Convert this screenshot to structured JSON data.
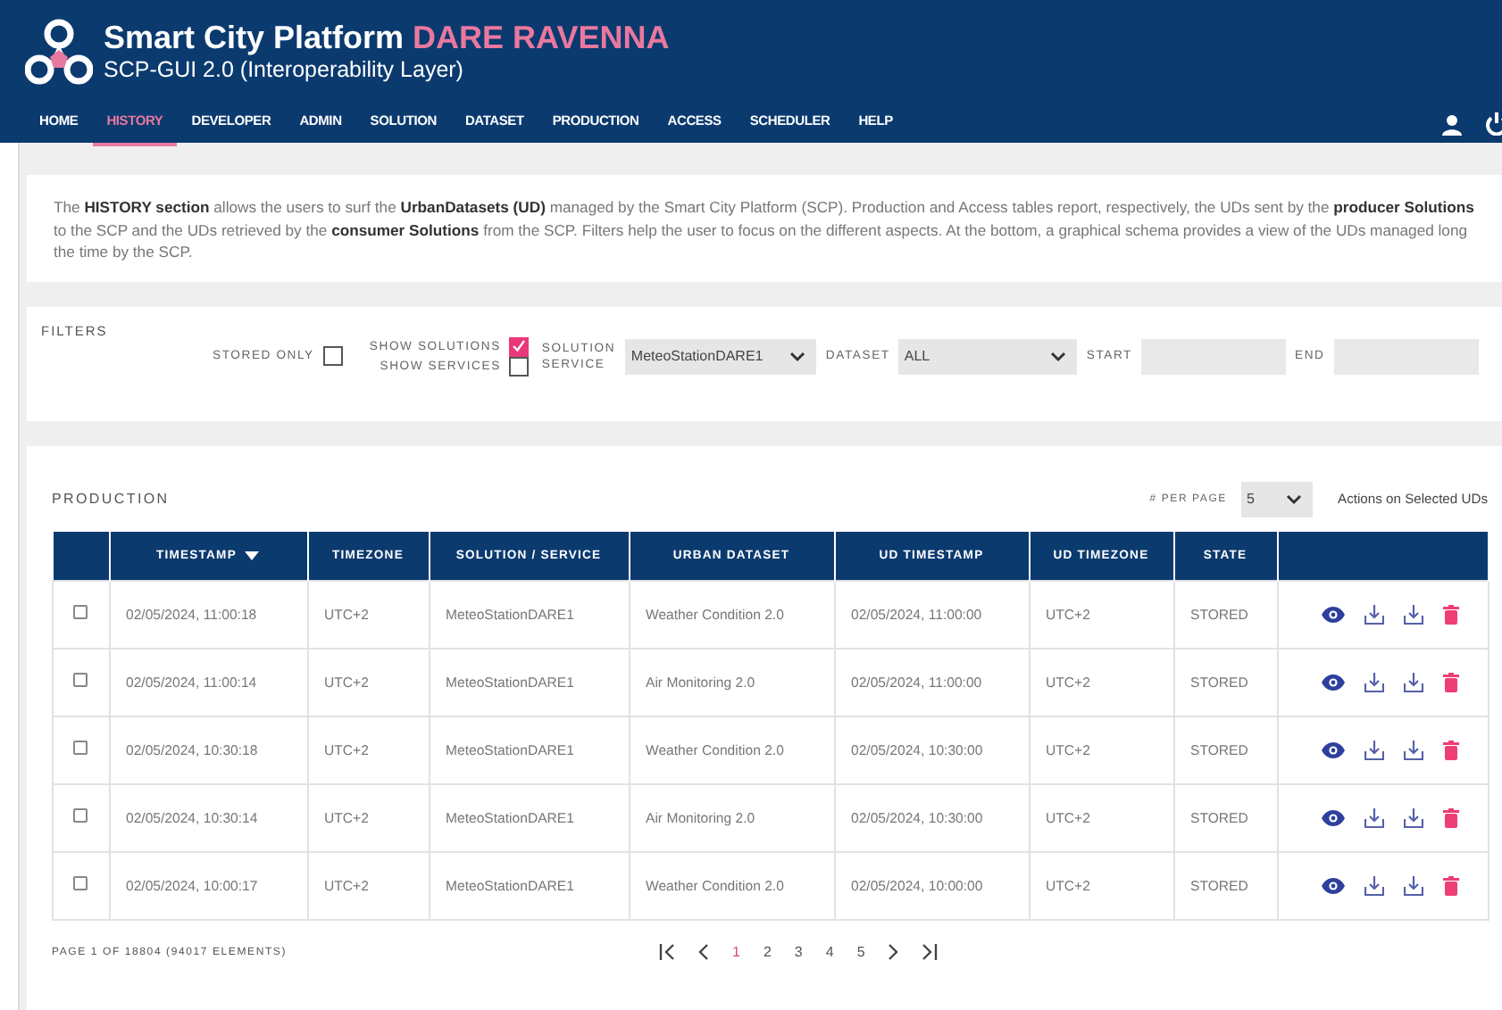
{
  "header": {
    "title": "Smart City Platform",
    "title_accent": "DARE RAVENNA",
    "subtitle": "SCP-GUI 2.0 (Interoperability Layer)"
  },
  "nav": [
    {
      "label": "HOME",
      "selected": false
    },
    {
      "label": "HISTORY",
      "selected": true
    },
    {
      "label": "DEVELOPER",
      "selected": false
    },
    {
      "label": "ADMIN",
      "selected": false
    },
    {
      "label": "SOLUTION",
      "selected": false
    },
    {
      "label": "DATASET",
      "selected": false
    },
    {
      "label": "PRODUCTION",
      "selected": false
    },
    {
      "label": "ACCESS",
      "selected": false
    },
    {
      "label": "SCHEDULER",
      "selected": false
    },
    {
      "label": "HELP",
      "selected": false
    }
  ],
  "intro": "The **HISTORY section** allows the users to surf the **UrbanDatasets (UD)** managed by the Smart City Platform (SCP). Production and Access tables report, respectively, the UDs sent by the **producer Solutions** to the SCP and the UDs retrieved by the **consumer Solutions** from the SCP. Filters help the user to focus on the different aspects. At the bottom, a graphical schema provides a view of the UDs managed long the time by the SCP.",
  "filters": {
    "title": "FILTERS",
    "stored_only": {
      "label": "STORED ONLY",
      "checked": false
    },
    "show_solutions": {
      "label": "SHOW SOLUTIONS",
      "checked": true
    },
    "show_services": {
      "label": "SHOW SERVICES",
      "checked": false
    },
    "solution_service": {
      "label": "SOLUTION SERVICE",
      "value": "MeteoStationDARE1"
    },
    "dataset": {
      "label": "DATASET",
      "value": "ALL"
    },
    "start": {
      "label": "START"
    },
    "end": {
      "label": "END"
    }
  },
  "production": {
    "title": "PRODUCTION",
    "per_page_label": "# PER PAGE",
    "per_page": "5",
    "actions_label": "Actions on Selected UDs",
    "columns": [
      "TIMESTAMP",
      "TIMEZONE",
      "SOLUTION / SERVICE",
      "URBAN DATASET",
      "UD TIMESTAMP",
      "UD TIMEZONE",
      "STATE"
    ],
    "rows": [
      {
        "checked": false,
        "cells": [
          "02/05/2024, 11:00:18",
          "UTC+2",
          "MeteoStationDARE1",
          "Weather Condition 2.0",
          "02/05/2024, 11:00:00",
          "UTC+2",
          "STORED"
        ]
      },
      {
        "checked": false,
        "cells": [
          "02/05/2024, 11:00:14",
          "UTC+2",
          "MeteoStationDARE1",
          "Air Monitoring 2.0",
          "02/05/2024, 11:00:00",
          "UTC+2",
          "STORED"
        ]
      },
      {
        "checked": false,
        "cells": [
          "02/05/2024, 10:30:18",
          "UTC+2",
          "MeteoStationDARE1",
          "Weather Condition 2.0",
          "02/05/2024, 10:30:00",
          "UTC+2",
          "STORED"
        ]
      },
      {
        "checked": false,
        "cells": [
          "02/05/2024, 10:30:14",
          "UTC+2",
          "MeteoStationDARE1",
          "Air Monitoring 2.0",
          "02/05/2024, 10:30:00",
          "UTC+2",
          "STORED"
        ]
      },
      {
        "checked": false,
        "cells": [
          "02/05/2024, 10:00:17",
          "UTC+2",
          "MeteoStationDARE1",
          "Weather Condition 2.0",
          "02/05/2024, 10:00:00",
          "UTC+2",
          "STORED"
        ]
      }
    ],
    "page_info": "PAGE 1 OF 18804 (94017 ELEMENTS)",
    "pages": [
      {
        "label": "1",
        "selected": true
      },
      {
        "label": "2",
        "selected": false
      },
      {
        "label": "3",
        "selected": false
      },
      {
        "label": "4",
        "selected": false
      },
      {
        "label": "5",
        "selected": false
      }
    ]
  }
}
